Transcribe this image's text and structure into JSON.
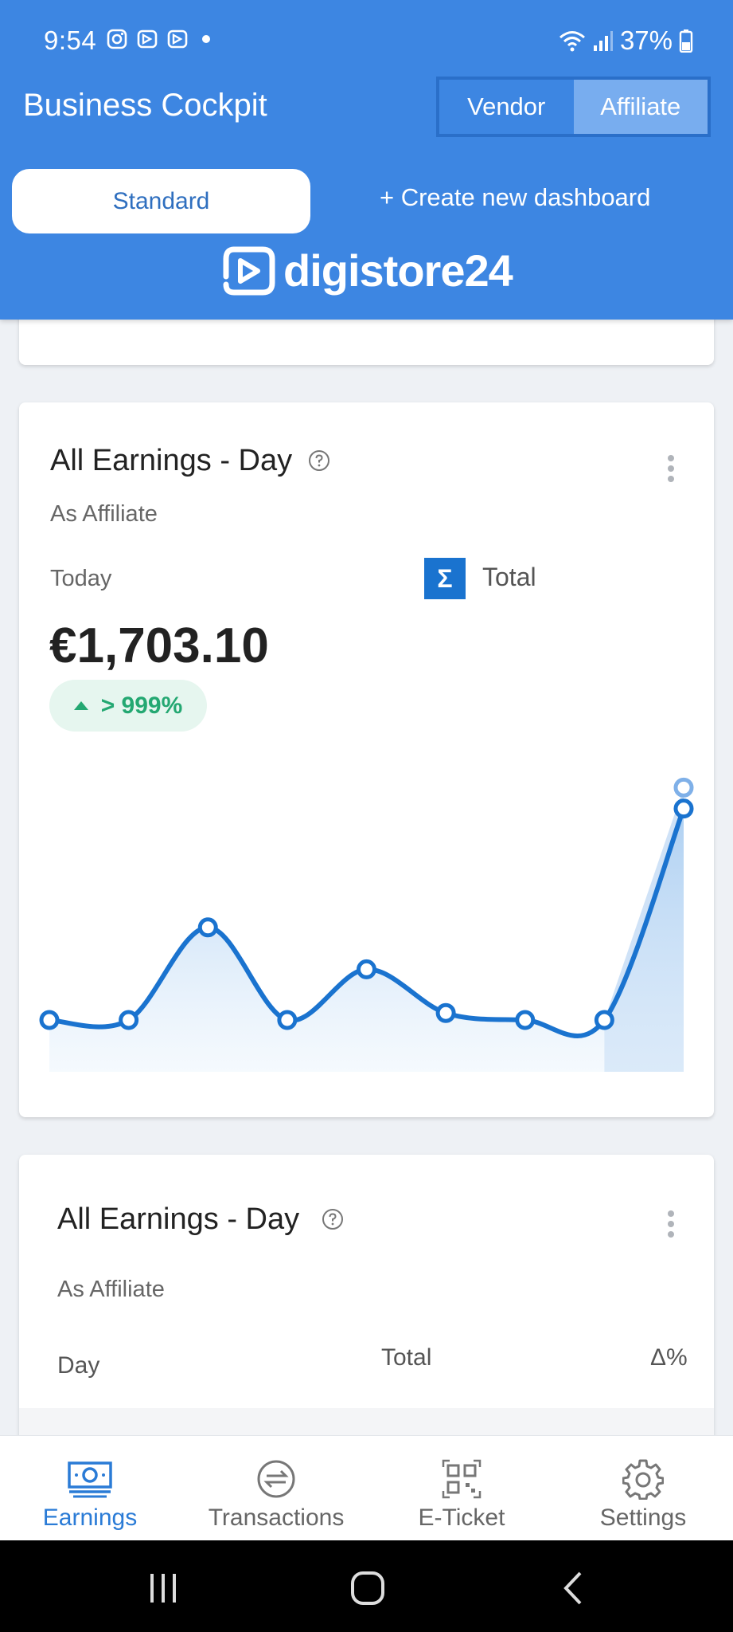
{
  "status_bar": {
    "time": "9:54",
    "battery": "37%"
  },
  "header": {
    "title": "Business Cockpit",
    "segment": {
      "vendor": "Vendor",
      "affiliate": "Affiliate",
      "selected": "Affiliate"
    },
    "dashboard_tab": "Standard",
    "create_dashboard": "+ Create new dashboard",
    "logo_text": "digistore24"
  },
  "colors": {
    "header_bg": "#3d86e2",
    "accent": "#1a73cf",
    "positive": "#24a872"
  },
  "card1": {
    "title": "All Earnings - Day",
    "subtitle": "As Affiliate",
    "period_label": "Today",
    "metric_label": "Total",
    "metric_icon": "sigma-icon",
    "amount": "€1,703.10",
    "change": "> 999%"
  },
  "chart_data": {
    "type": "line",
    "title": "All Earnings - Day",
    "xlabel": "",
    "ylabel": "",
    "x": [
      1,
      2,
      3,
      4,
      5,
      6,
      7,
      8,
      9
    ],
    "series": [
      {
        "values": [
          0,
          0,
          53,
          0,
          29,
          4,
          0,
          0,
          121
        ]
      }
    ],
    "highlight_value": 133,
    "ylim": [
      0,
      140
    ],
    "grid": false,
    "legend": "none"
  },
  "card2": {
    "title": "All Earnings - Day",
    "subtitle": "As Affiliate",
    "columns": [
      "Day",
      "Total",
      "Δ%"
    ]
  },
  "bottom_nav": [
    {
      "label": "Earnings",
      "icon": "banknote-icon",
      "active": true
    },
    {
      "label": "Transactions",
      "icon": "transfer-icon",
      "active": false
    },
    {
      "label": "E-Ticket",
      "icon": "qr-code-icon",
      "active": false
    },
    {
      "label": "Settings",
      "icon": "gear-icon",
      "active": false
    }
  ]
}
